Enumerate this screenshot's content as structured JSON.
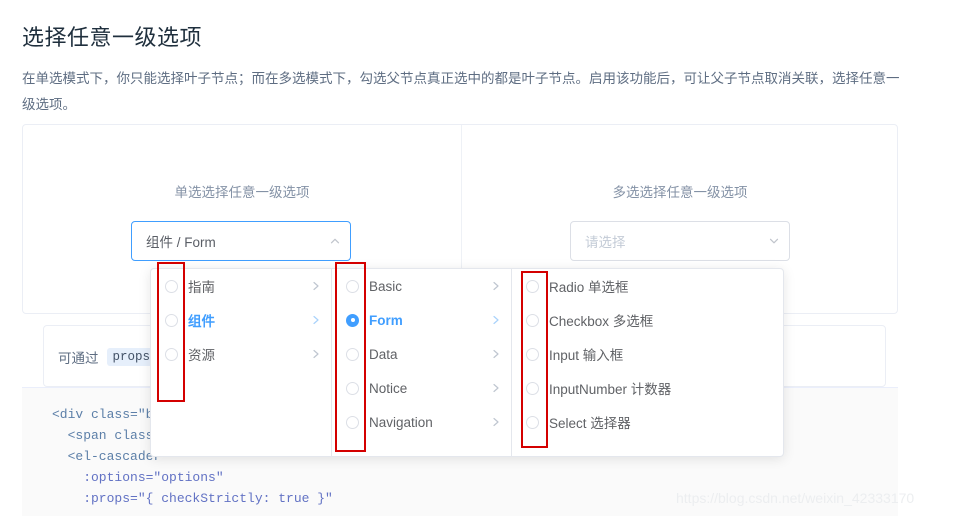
{
  "page": {
    "title": "选择任意一级选项",
    "description": "在单选模式下，你只能选择叶子节点；而在多选模式下，勾选父节点真正选中的都是叶子节点。启用该功能后，可让父子节点取消关联，选择任意一级选项。"
  },
  "demo": {
    "left": {
      "label": "单选选择任意一级选项",
      "cascader": {
        "value": "组件 / Form",
        "placeholder": "请选择",
        "arrow_icon": "chevron-up-icon",
        "focused": true
      }
    },
    "right": {
      "label": "多选选择任意一级选项",
      "cascader": {
        "value": "",
        "placeholder": "请选择",
        "arrow_icon": "chevron-down-icon",
        "focused": false
      }
    }
  },
  "dropdown": {
    "panels": [
      {
        "name": "level-1",
        "nodes": [
          {
            "label": "指南",
            "checked": false,
            "active": false,
            "has_children": true
          },
          {
            "label": "组件",
            "checked": false,
            "active": true,
            "has_children": true
          },
          {
            "label": "资源",
            "checked": false,
            "active": false,
            "has_children": true
          }
        ]
      },
      {
        "name": "level-2",
        "nodes": [
          {
            "label": "Basic",
            "checked": false,
            "active": false,
            "has_children": true
          },
          {
            "label": "Form",
            "checked": true,
            "active": true,
            "has_children": true
          },
          {
            "label": "Data",
            "checked": false,
            "active": false,
            "has_children": true
          },
          {
            "label": "Notice",
            "checked": false,
            "active": false,
            "has_children": true
          },
          {
            "label": "Navigation",
            "checked": false,
            "active": false,
            "has_children": true
          }
        ]
      },
      {
        "name": "level-3",
        "nodes": [
          {
            "label": "Radio 单选框",
            "checked": false,
            "active": false,
            "has_children": false
          },
          {
            "label": "Checkbox 多选框",
            "checked": false,
            "active": false,
            "has_children": false
          },
          {
            "label": "Input 输入框",
            "checked": false,
            "active": false,
            "has_children": false
          },
          {
            "label": "InputNumber 计数器",
            "checked": false,
            "active": false,
            "has_children": false
          },
          {
            "label": "Select 选择器",
            "checked": false,
            "active": false,
            "has_children": false
          }
        ]
      }
    ]
  },
  "tip": {
    "text": "可通过",
    "code": "props"
  },
  "code_block": {
    "lines": [
      [
        {
          "t": "tag",
          "s": "<div class=\"bl"
        }
      ],
      [
        {
          "t": "tag",
          "s": "  <span class="
        }
      ],
      [
        {
          "t": "tag",
          "s": "  <el-cascader"
        }
      ],
      [
        {
          "t": "attr",
          "s": "    :options=\"options\""
        }
      ],
      [
        {
          "t": "attr",
          "s": "    :props=\"{ checkStrictly: true }\""
        }
      ]
    ]
  },
  "watermark": "https://blog.csdn.net/weixin_42333170",
  "colors": {
    "accent": "#409eff",
    "text": "#606266",
    "muted": "#8492a6",
    "border": "#e4e7ed",
    "annotation": "#d40000"
  }
}
